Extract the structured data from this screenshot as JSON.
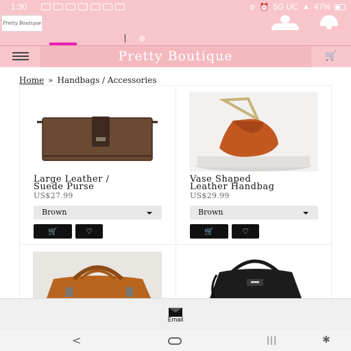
{
  "status_bar": {
    "time": "1:30",
    "network": "5G UC",
    "battery": "47%",
    "icons": [
      "email-notif-icon",
      "voicemail-icon",
      "gmail-icon",
      "tmobile-icon",
      "tmobile-icon",
      "cloud-icon",
      "bird-icon",
      "dot-icon"
    ]
  },
  "header": {
    "logo_text": "Pretty Boutique",
    "user_icon": "user-icon",
    "bell_icon": "bell-icon"
  },
  "nav": {
    "title": "Pretty Boutique",
    "menu_icon": "hamburger-icon",
    "cart_icon": "cart-icon"
  },
  "breadcrumb": {
    "home": "Home",
    "separator": "»",
    "current": "Handbags / Accessories"
  },
  "products": [
    {
      "name_line1": "Large Leather /",
      "name_line2": "Suede Purse",
      "price": "US$27.99",
      "color": "Brown"
    },
    {
      "name_line1": "Vase Shaped",
      "name_line2": "Leather Handbag",
      "price": "US$29.99",
      "color": "Brown"
    },
    {
      "image": "tan-leather-satchel"
    },
    {
      "image": "black-leather-bucket-bag"
    }
  ],
  "footer": {
    "email_label": "Email"
  }
}
